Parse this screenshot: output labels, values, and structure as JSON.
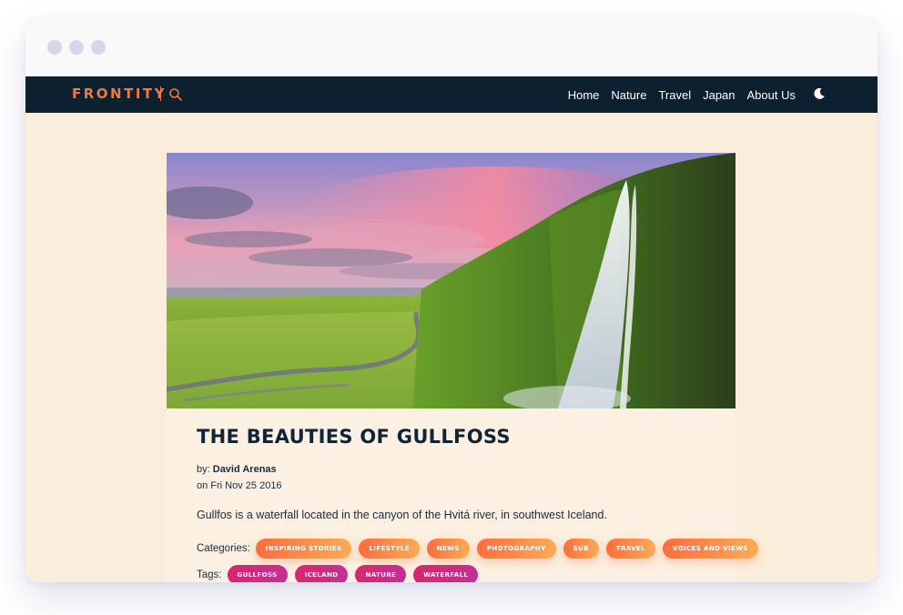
{
  "window": {
    "controls": [
      "dot-1",
      "dot-2",
      "dot-3"
    ]
  },
  "navbar": {
    "logo_text": "FRONTITY",
    "menu": [
      {
        "label": "Home"
      },
      {
        "label": "Nature"
      },
      {
        "label": "Travel"
      },
      {
        "label": "Japan"
      },
      {
        "label": "About Us"
      }
    ],
    "icons": {
      "search": "search-icon",
      "theme": "moon-icon"
    }
  },
  "post": {
    "title": "THE BEAUTIES OF GULLFOSS",
    "by_prefix": "by:",
    "author": "David Arenas",
    "date": "on Fri Nov 25 2016",
    "excerpt": "Gullfos is a waterfall located in the canyon of the Hvitá river, in southwest Iceland.",
    "categories_label": "Categories:",
    "categories": [
      "INSPIRING STORIES",
      "LIFESTYLE",
      "NEWS",
      "PHOTOGRAPHY",
      "SUB",
      "TRAVEL",
      "VOICES AND VIEWS"
    ],
    "tags_label": "Tags:",
    "tags": [
      "GULLFOSS",
      "ICELAND",
      "NATURE",
      "WATERFALL"
    ]
  },
  "colors": {
    "navbar_bg": "#0c2030",
    "brand_orange": "#f07a3a",
    "page_bg": "#fbeddb",
    "category_gradient": [
      "#ff6c3e",
      "#fcab55"
    ],
    "tag_gradient": [
      "#d9266a",
      "#c23196"
    ]
  }
}
